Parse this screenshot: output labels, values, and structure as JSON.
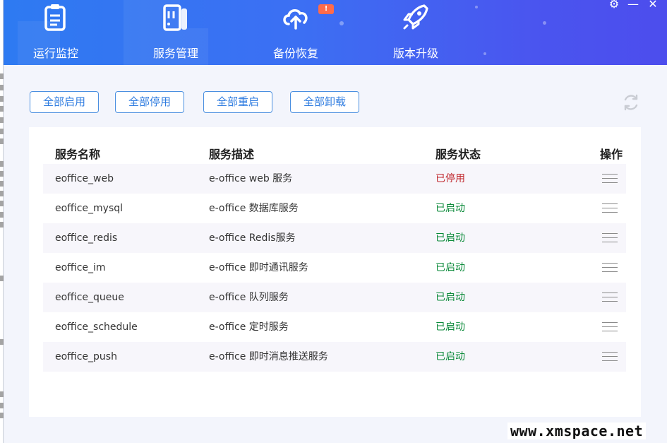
{
  "nav": [
    {
      "label": "运行监控",
      "icon": "clipboard-icon"
    },
    {
      "label": "服务管理",
      "icon": "server-icon"
    },
    {
      "label": "备份恢复",
      "icon": "cloud-upload-icon",
      "badge": "!"
    },
    {
      "label": "版本升级",
      "icon": "rocket-icon"
    }
  ],
  "window_controls": {
    "settings": "⚙",
    "minimize": "—",
    "close": "✕"
  },
  "actions": {
    "enable_all": "全部启用",
    "disable_all": "全部停用",
    "restart_all": "全部重启",
    "uninstall_all": "全部卸载"
  },
  "table": {
    "headers": {
      "name": "服务名称",
      "desc": "服务描述",
      "status": "服务状态",
      "ops": "操作"
    },
    "rows": [
      {
        "name": "eoffice_web",
        "desc": "e-office web 服务",
        "status": "已停用",
        "state": "stopped"
      },
      {
        "name": "eoffice_mysql",
        "desc": "e-office 数据库服务",
        "status": "已启动",
        "state": "started"
      },
      {
        "name": "eoffice_redis",
        "desc": "e-office Redis服务",
        "status": "已启动",
        "state": "started"
      },
      {
        "name": "eoffice_im",
        "desc": "e-office 即时通讯服务",
        "status": "已启动",
        "state": "started"
      },
      {
        "name": "eoffice_queue",
        "desc": "e-office 队列服务",
        "status": "已启动",
        "state": "started"
      },
      {
        "name": "eoffice_schedule",
        "desc": "e-office 定时服务",
        "status": "已启动",
        "state": "started"
      },
      {
        "name": "eoffice_push",
        "desc": "e-office 即时消息推送服务",
        "status": "已启动",
        "state": "started"
      }
    ]
  },
  "watermark": "www.xmspace.net",
  "colors": {
    "header_start": "#2e7af2",
    "header_end": "#4c4ded",
    "accent": "#2f7ce0",
    "status_stopped": "#c0272d",
    "status_started": "#0b8a3a"
  }
}
